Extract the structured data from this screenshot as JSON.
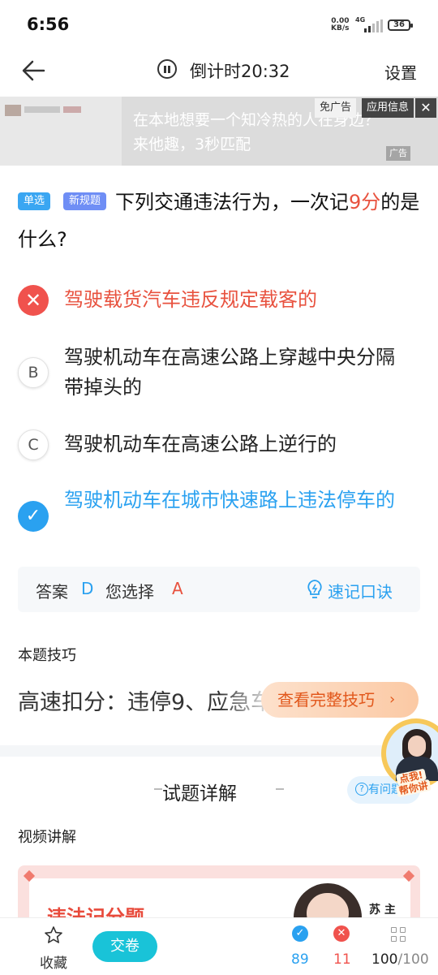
{
  "status_bar": {
    "time": "6:56",
    "speed_value": "0.00",
    "speed_unit": "KB/s",
    "network": "4G",
    "battery": "36"
  },
  "nav": {
    "countdown": "倒计时20:32",
    "settings": "设置"
  },
  "ad": {
    "line1": "在本地想要一个知冷热的人在身边？",
    "line2": "来他趣，3秒匹配",
    "free_ad": "免广告",
    "app_info": "应用信息",
    "ad_tag": "广告"
  },
  "question": {
    "tag_type": "单选",
    "tag_rule": "新规题",
    "text_before": "下列交通违法行为，一次记",
    "text_highlight": "9分",
    "text_after": "的是什么?",
    "highlight_color": "#e8523f"
  },
  "options": [
    {
      "letter": "A",
      "text": "驾驶载货汽车违反规定载客的",
      "state": "wrong"
    },
    {
      "letter": "B",
      "text": "驾驶机动车在高速公路上穿越中央分隔带掉头的",
      "state": "normal"
    },
    {
      "letter": "C",
      "text": "驾驶机动车在高速公路上逆行的",
      "state": "normal"
    },
    {
      "letter": "D",
      "text": "驾驶机动车在城市快速路上违法停车的",
      "state": "correct"
    }
  ],
  "answer": {
    "answer_label": "答案",
    "correct": "D",
    "selected_label": "您选择",
    "selected": "A",
    "mnemonic": "速记口诀"
  },
  "tip": {
    "title": "本题技巧",
    "text": "高速扣分：违停9、应急车道6",
    "button": "查看完整技巧"
  },
  "explanation": {
    "title": "试题详解",
    "ask": "有问题",
    "video_title": "视频讲解",
    "video_text": "违法记分题",
    "video_name": "苏 主"
  },
  "floating": {
    "line1": "点我!",
    "line2": "帮你讲"
  },
  "bottom": {
    "favorite": "收藏",
    "submit": "交卷",
    "correct_count": "89",
    "wrong_count": "11",
    "progress_current": "100",
    "progress_total": "/100"
  },
  "colors": {
    "accent_blue": "#2aa1f0",
    "wrong_red": "#f0524d",
    "submit_teal": "#19c3d8"
  }
}
